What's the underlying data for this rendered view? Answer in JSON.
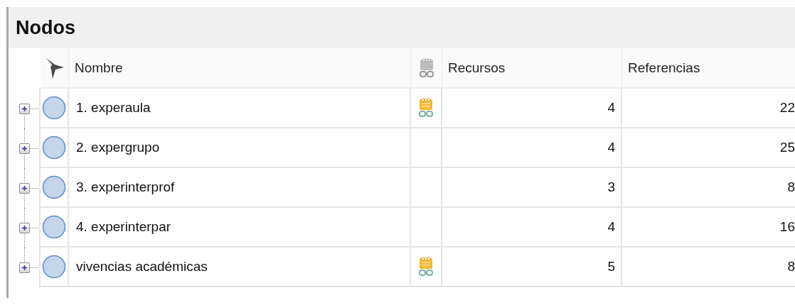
{
  "panel": {
    "title": "Nodos"
  },
  "table": {
    "columns": [
      "Nombre",
      "Recursos",
      "Referencias"
    ],
    "rows": [
      {
        "name": "1. experaula",
        "expanded": false,
        "has_memo": true,
        "recursos": "4",
        "referencias": "22"
      },
      {
        "name": "2. expergrupo",
        "expanded": false,
        "has_memo": false,
        "recursos": "4",
        "referencias": "25"
      },
      {
        "name": "3. experinterprof",
        "expanded": false,
        "has_memo": false,
        "recursos": "3",
        "referencias": "8"
      },
      {
        "name": "4. experinterpar",
        "expanded": false,
        "has_memo": false,
        "recursos": "4",
        "referencias": "16"
      },
      {
        "name": "vivencias académicas",
        "expanded": false,
        "has_memo": true,
        "recursos": "5",
        "referencias": "8"
      }
    ]
  }
}
